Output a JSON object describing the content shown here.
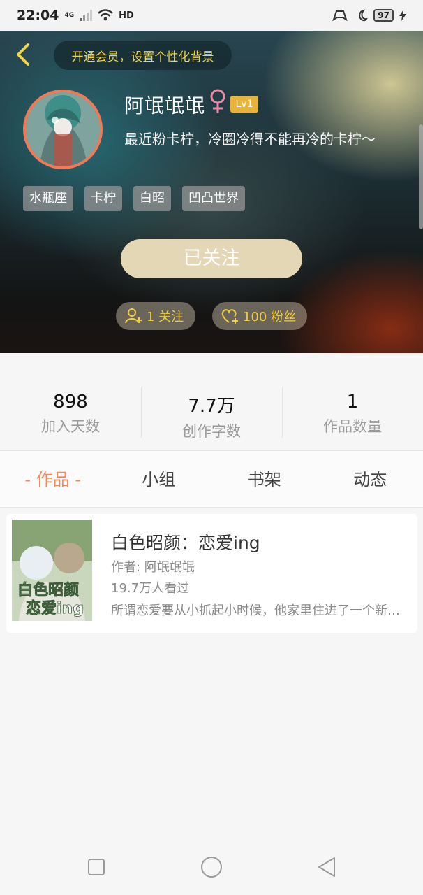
{
  "status_bar": {
    "time": "22:04",
    "network": "4G",
    "hd": "HD",
    "battery": "97"
  },
  "header": {
    "vip_banner": "开通会员，设置个性化背景",
    "name": "阿氓氓氓",
    "gender_symbol": "♀",
    "level": "Lv1",
    "bio": "最近粉卡柠，冷圈冷得不能再冷的卡柠～",
    "tags": [
      "水瓶座",
      "卡柠",
      "白昭",
      "凹凸世界"
    ],
    "follow_button": "已关注",
    "following_count": "1 关注",
    "fans_count": "100 粉丝"
  },
  "stats": [
    {
      "value": "898",
      "label": "加入天数"
    },
    {
      "value": "7.7万",
      "label": "创作字数"
    },
    {
      "value": "1",
      "label": "作品数量"
    }
  ],
  "tabs": [
    {
      "label": "- 作品 -",
      "active": true
    },
    {
      "label": "小组",
      "active": false
    },
    {
      "label": "书架",
      "active": false
    },
    {
      "label": "动态",
      "active": false
    }
  ],
  "works": [
    {
      "cover_text": "白色昭颜恋爱ing",
      "title": "白色昭颜：恋爱ing",
      "author": "作者: 阿氓氓氓",
      "views": "19.7万人看过",
      "description": "所谓恋爱要从小抓起小时候，他家里住进了一个新来的孩子……"
    }
  ],
  "colors": {
    "accent": "#f2875d",
    "gold": "#f0cd42",
    "follow_button": "#e4d7b6",
    "level_badge": "#e9b33a"
  }
}
